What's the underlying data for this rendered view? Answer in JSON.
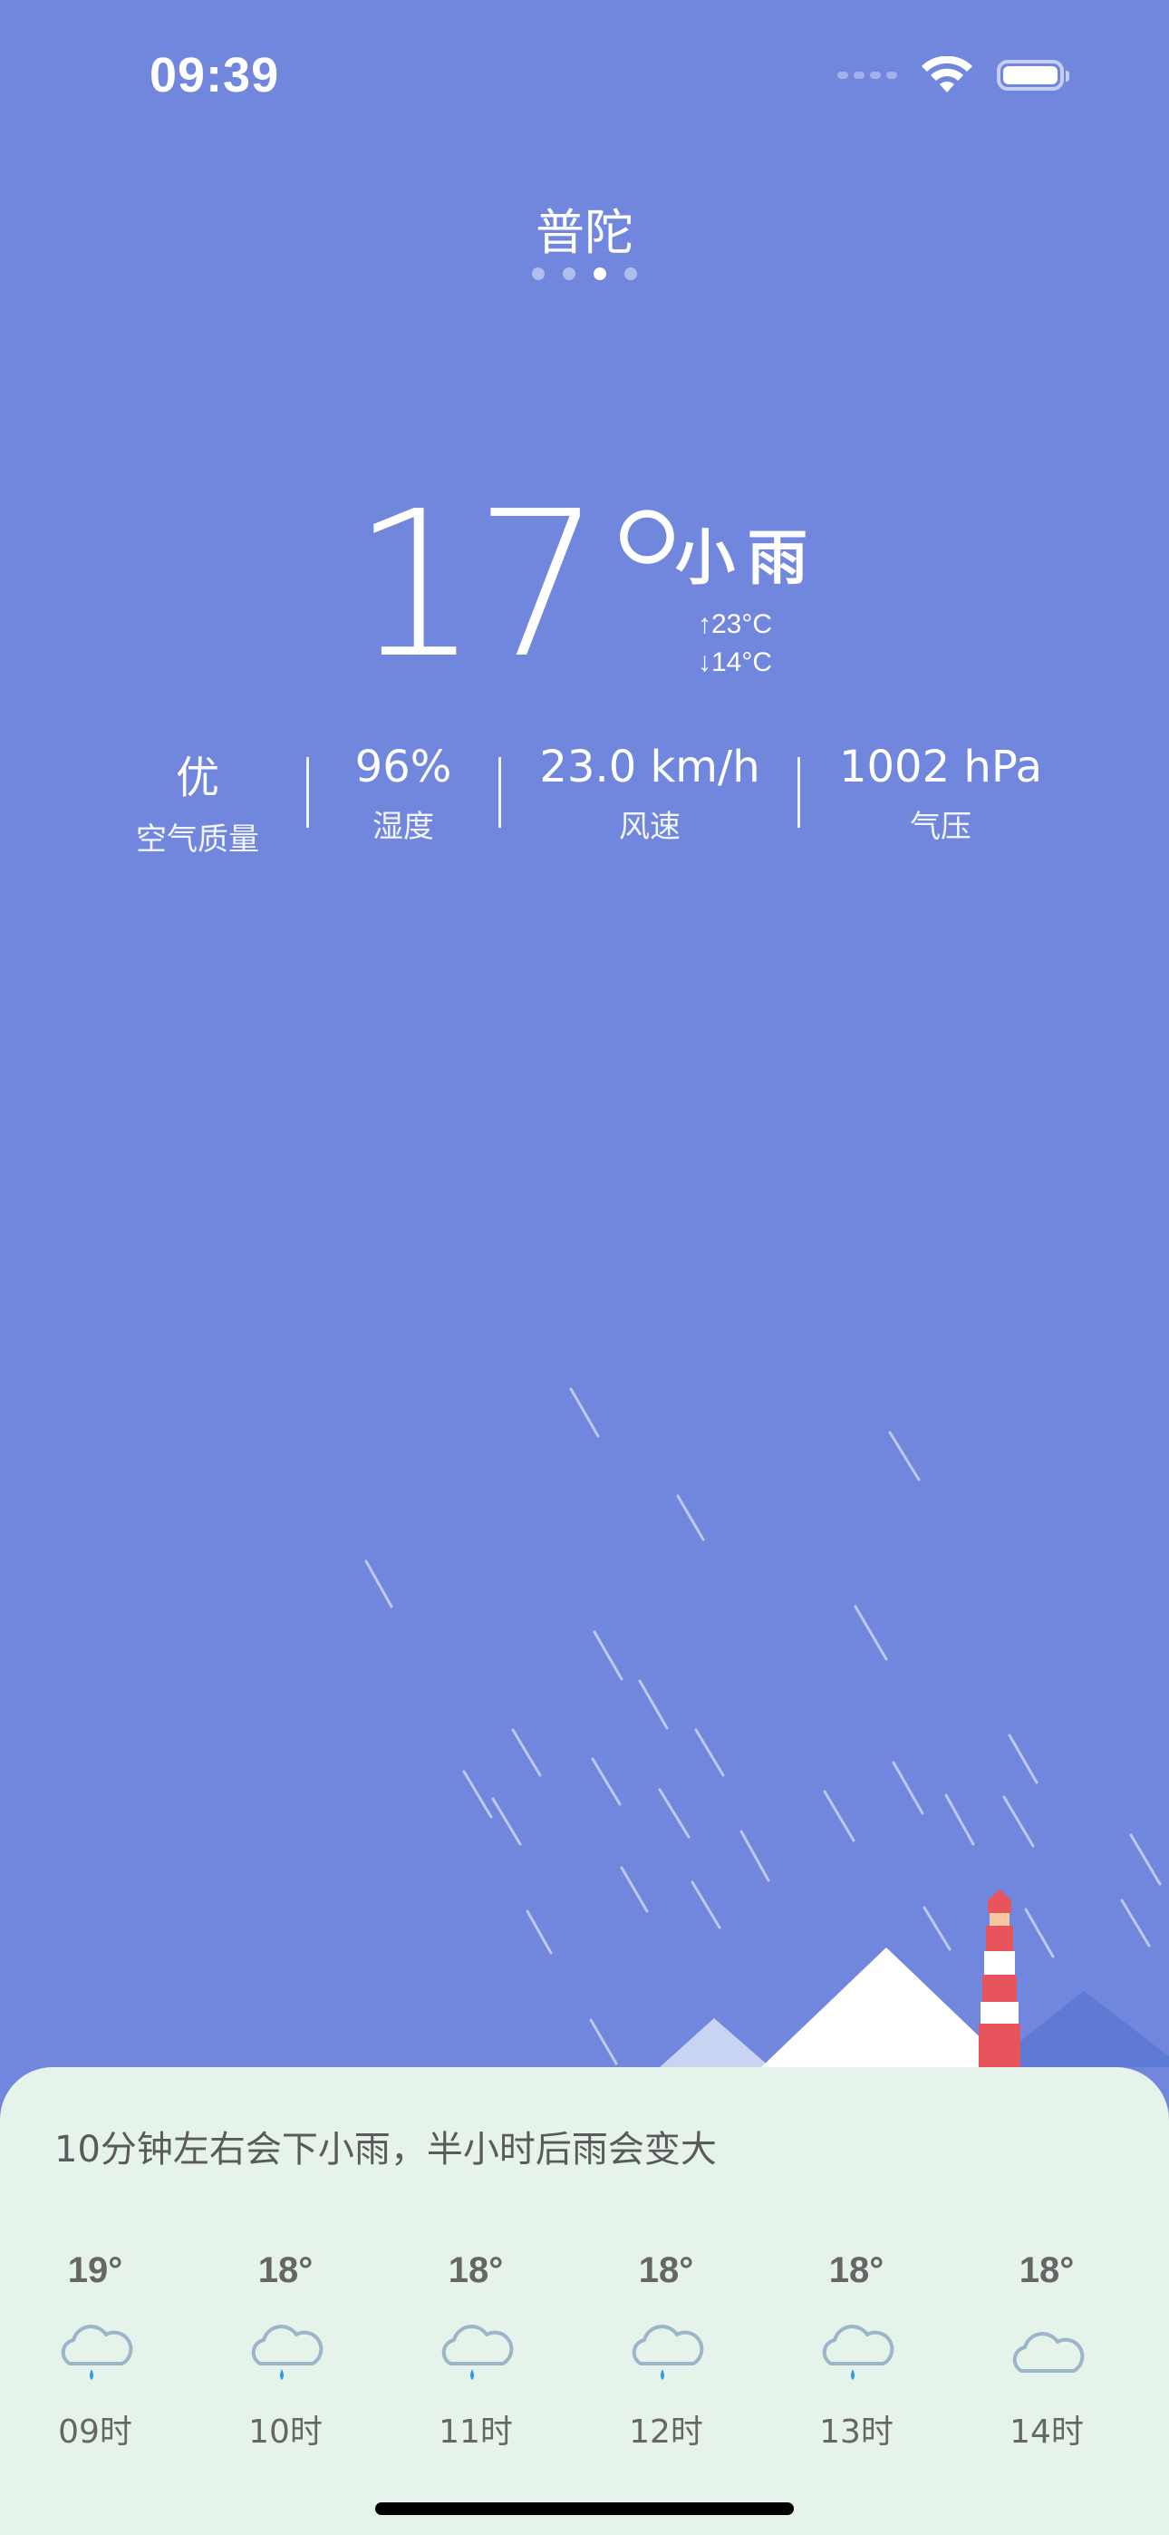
{
  "status_bar": {
    "time": "09:39",
    "icons": [
      "cellular-signal-icon",
      "wifi-icon",
      "battery-icon"
    ]
  },
  "location": {
    "city": "普陀",
    "page_count": 4,
    "active_page": 3
  },
  "current": {
    "temperature": "17°",
    "condition": "小雨",
    "high": "↑23°C",
    "low": "↓14°C"
  },
  "metrics": [
    {
      "value": "优",
      "label": "空气质量"
    },
    {
      "value": "96%",
      "label": "湿度"
    },
    {
      "value": "23.0 km/h",
      "label": "风速"
    },
    {
      "value": "1002 hPa",
      "label": "气压"
    }
  ],
  "forecast": {
    "summary": "10分钟左右会下小雨，半小时后雨会变大",
    "hours": [
      {
        "temp": "19°",
        "time": "09时",
        "icon": "light-rain-icon"
      },
      {
        "temp": "18°",
        "time": "10时",
        "icon": "light-rain-icon"
      },
      {
        "temp": "18°",
        "time": "11时",
        "icon": "light-rain-icon"
      },
      {
        "temp": "18°",
        "time": "12时",
        "icon": "light-rain-icon"
      },
      {
        "temp": "18°",
        "time": "13时",
        "icon": "light-rain-icon"
      },
      {
        "temp": "18°",
        "time": "14时",
        "icon": "cloudy-icon"
      }
    ]
  },
  "colors": {
    "background": "#7187DD",
    "panel": "#E6F3EA",
    "rain_drop": "#2E9BE8",
    "cloud_outline": "#9DB5C8",
    "lighthouse_red": "#E8545C"
  }
}
